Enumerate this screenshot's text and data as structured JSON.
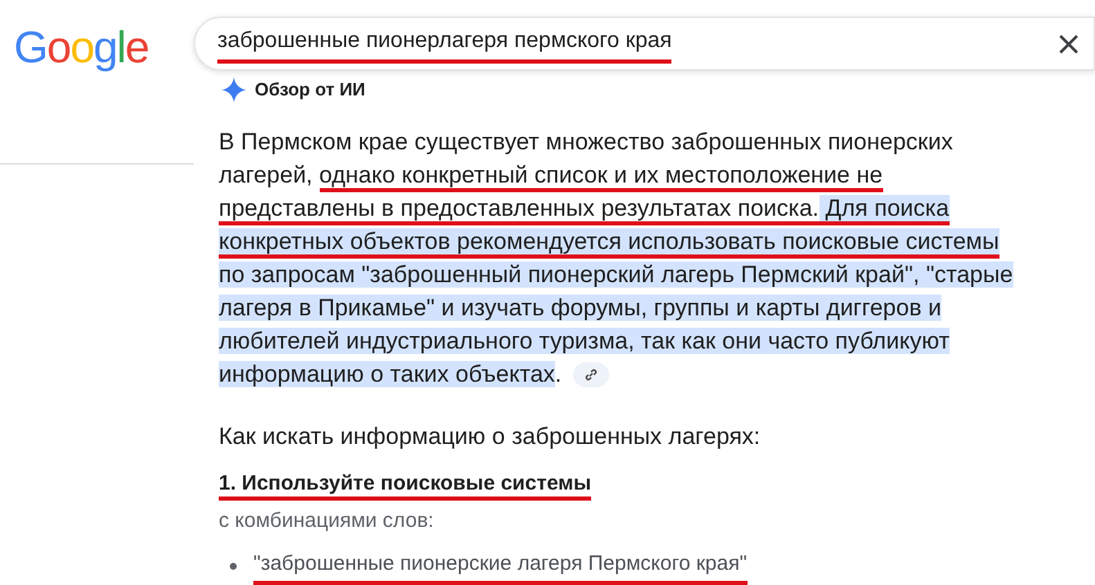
{
  "logo": "Google",
  "search": {
    "value": "заброшенные пионерлагеря пермского края",
    "underlined": true
  },
  "ai_overview": {
    "title": "Обзор от ИИ",
    "paragraph": [
      {
        "text": "В Пермском крае существует множество заброшенных пионерских лагерей, ",
        "underlined": false,
        "highlighted": false
      },
      {
        "text": "однако конкретный список и их местоположение не представлены в предоставленных результатах поиска.",
        "underlined": true,
        "highlighted": false
      },
      {
        "text": " Для поиска конкретных объектов рекомендуется использовать поисковые системы",
        "underlined": true,
        "highlighted": true
      },
      {
        "text": " по запросам \"заброшенный пионерский лагерь Пермский край\", \"старые лагеря в Прикамье\" и изучать форумы, группы и карты диггеров и любителей индустриального туризма, так как они часто публикуют информацию о таких объектах",
        "underlined": false,
        "highlighted": true
      },
      {
        "text": ".",
        "underlined": false,
        "highlighted": false
      }
    ],
    "heading": "Как искать информацию о заброшенных лагерях:",
    "step": {
      "title": "1. Используйте поисковые системы",
      "underlined": true
    },
    "step_note": "с комбинациями слов:",
    "bullets": [
      {
        "text": "\"заброшенные пионерские лагеря Пермского края\"",
        "underlined": true
      }
    ]
  }
}
